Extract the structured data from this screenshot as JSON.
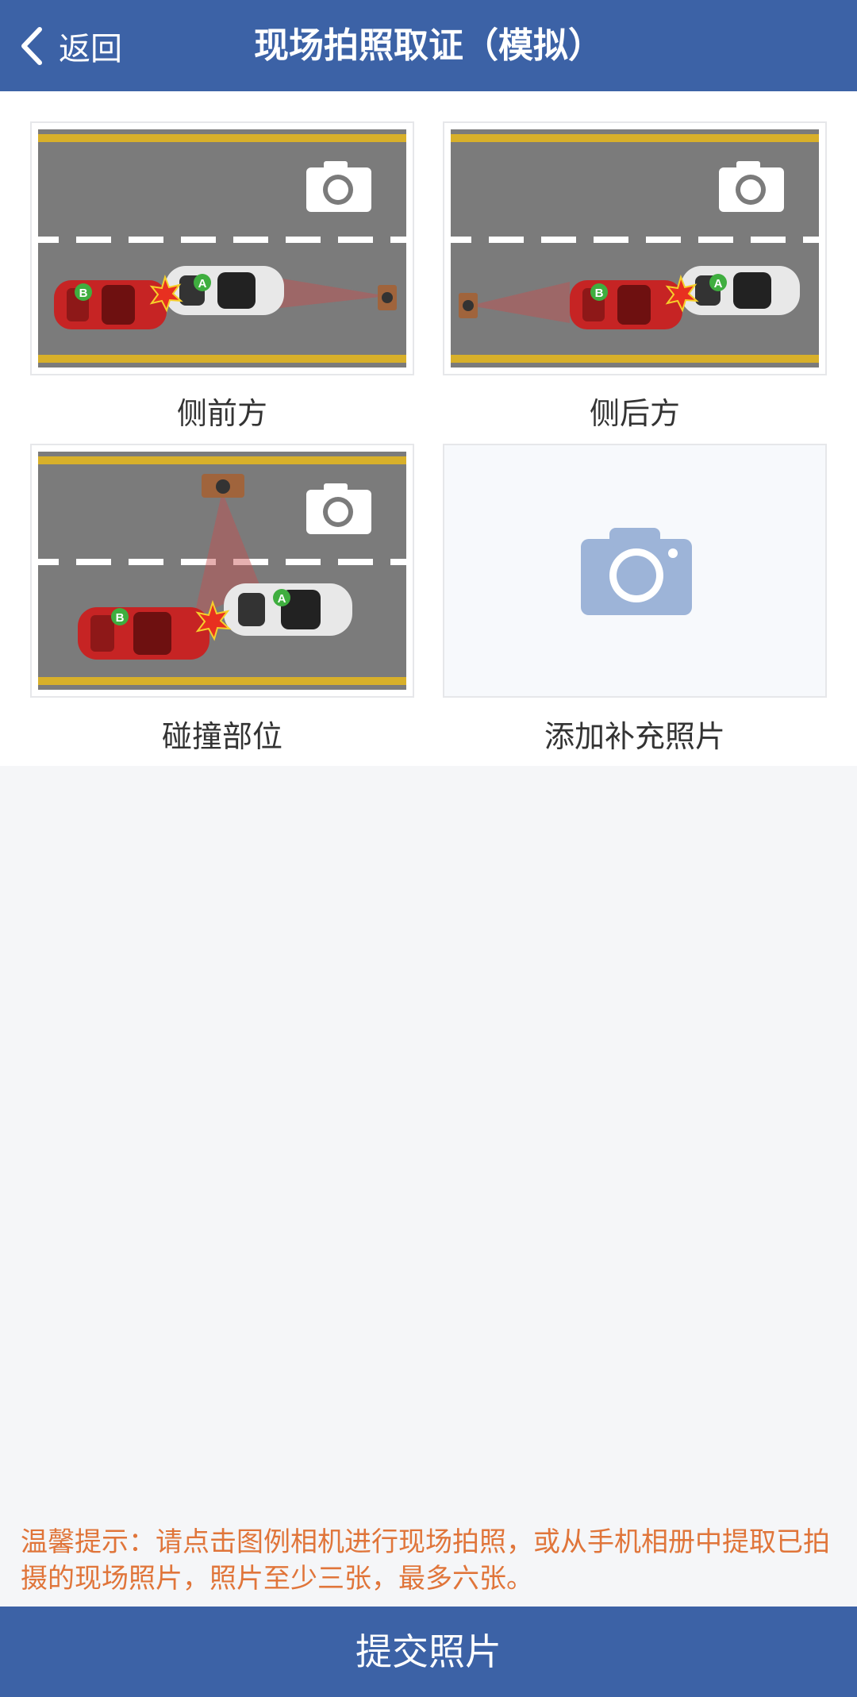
{
  "header": {
    "back_label": "返回",
    "title": "现场拍照取证（模拟）"
  },
  "photos": [
    {
      "caption": "侧前方",
      "car_a": "A",
      "car_b": "B"
    },
    {
      "caption": "侧后方",
      "car_a": "A",
      "car_b": "B"
    },
    {
      "caption": "碰撞部位",
      "car_a": "A",
      "car_b": "B"
    },
    {
      "caption": "添加补充照片"
    }
  ],
  "hint": "温馨提示：请点击图例相机进行现场拍照，或从手机相册中提取已拍摄的现场照片，照片至少三张，最多六张。",
  "submit_label": "提交照片",
  "colors": {
    "header_bg": "#3c62a6",
    "hint_text": "#e0753a",
    "road": "#7b7b7b",
    "lane_line_yellow": "#d8b02a",
    "car_b_red": "#c62424",
    "add_camera": "#9db4d8"
  }
}
